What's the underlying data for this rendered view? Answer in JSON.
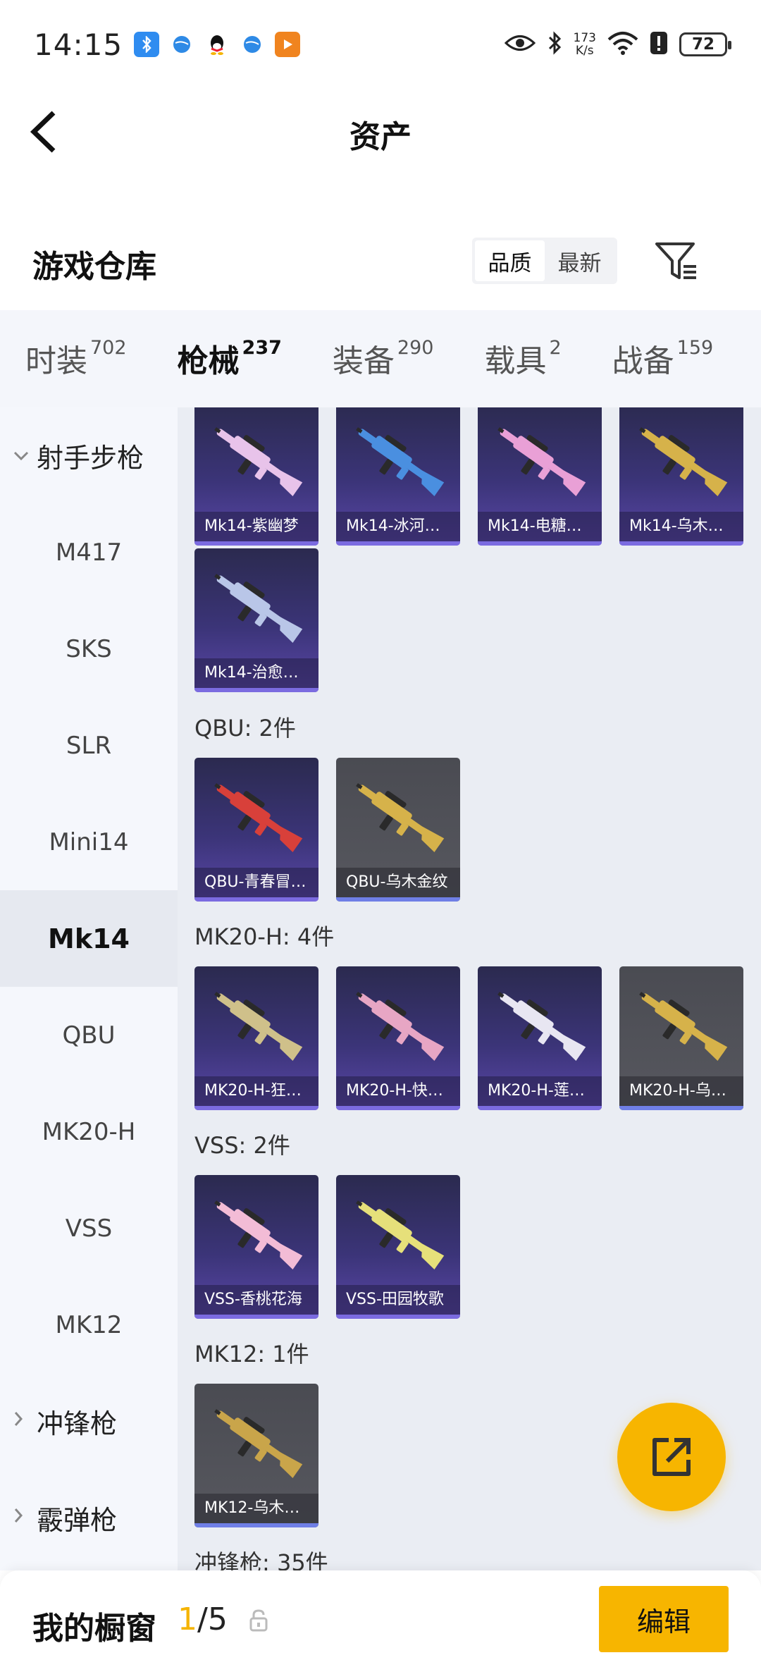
{
  "status_bar": {
    "time": "14:15",
    "net_speed_value": "173",
    "net_speed_unit": "K/s",
    "battery": "72",
    "icons": [
      "bluetooth-app-icon",
      "browser-icon",
      "qq-icon",
      "browser-icon",
      "video-icon",
      "eye-icon",
      "bluetooth-icon",
      "wifi-icon",
      "alert-icon",
      "battery-icon"
    ]
  },
  "header": {
    "title": "资产"
  },
  "warehouse": {
    "title": "游戏仓库",
    "sort_options": [
      "品质",
      "最新"
    ],
    "active_sort": "品质"
  },
  "tabs": [
    {
      "label": "时装",
      "count": "702"
    },
    {
      "label": "枪械",
      "count": "237"
    },
    {
      "label": "装备",
      "count": "290"
    },
    {
      "label": "载具",
      "count": "2"
    },
    {
      "label": "战备",
      "count": "159"
    }
  ],
  "active_tab": "枪械",
  "sidebar": {
    "group_open": "射手步枪",
    "items": [
      "M417",
      "SKS",
      "SLR",
      "Mini14",
      "Mk14",
      "QBU",
      "MK20-H",
      "VSS",
      "MK12"
    ],
    "active_item": "Mk14",
    "collapsed_groups": [
      "冲锋枪",
      "霰弹枪"
    ]
  },
  "sections": [
    {
      "title": "",
      "items": [
        {
          "name": "Mk14-紫幽梦",
          "tone": "purple",
          "gun_color": "#e8c3ea"
        },
        {
          "name": "Mk14-冰河…",
          "tone": "purple",
          "gun_color": "#4a8fe0"
        },
        {
          "name": "Mk14-电糖…",
          "tone": "purple",
          "gun_color": "#e9a0d6"
        },
        {
          "name": "Mk14-乌木…",
          "tone": "purple",
          "gun_color": "#d6b24a"
        },
        {
          "name": "Mk14-治愈…",
          "tone": "purple",
          "gun_color": "#b9c6e8"
        }
      ]
    },
    {
      "title": "QBU: 2件",
      "items": [
        {
          "name": "QBU-青春冒…",
          "tone": "purple",
          "gun_color": "#d8403a"
        },
        {
          "name": "QBU-乌木金纹",
          "tone": "grey",
          "gun_color": "#d6b24a"
        }
      ]
    },
    {
      "title": "MK20-H: 4件",
      "items": [
        {
          "name": "MK20-H-狂…",
          "tone": "purple",
          "gun_color": "#cfc08a"
        },
        {
          "name": "MK20-H-快…",
          "tone": "purple",
          "gun_color": "#e7a6c4"
        },
        {
          "name": "MK20-H-莲…",
          "tone": "purple",
          "gun_color": "#e8e6f2"
        },
        {
          "name": "MK20-H-乌…",
          "tone": "grey",
          "gun_color": "#d6b24a"
        }
      ]
    },
    {
      "title": "VSS: 2件",
      "items": [
        {
          "name": "VSS-香桃花海",
          "tone": "purple",
          "gun_color": "#f3bcd6"
        },
        {
          "name": "VSS-田园牧歌",
          "tone": "purple",
          "gun_color": "#e6e07a"
        }
      ]
    },
    {
      "title": "MK12: 1件",
      "items": [
        {
          "name": "MK12-乌木…",
          "tone": "grey",
          "gun_color": "#c9a54a"
        }
      ]
    },
    {
      "title": "冲锋枪: 35件",
      "items": []
    }
  ],
  "bottom_bar": {
    "title": "我的橱窗",
    "current": "1",
    "total": "/5",
    "edit_label": "编辑"
  }
}
